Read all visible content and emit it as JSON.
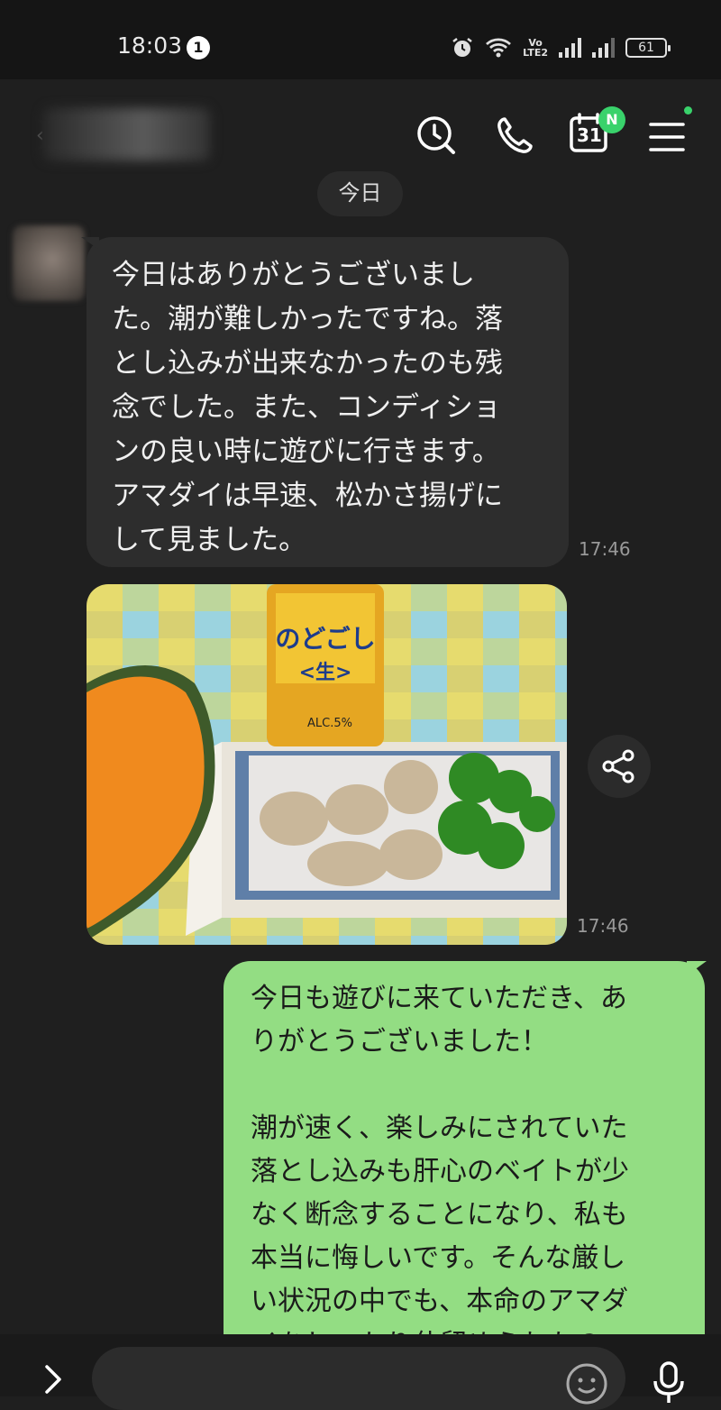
{
  "status_bar": {
    "time": "18:03",
    "notification_count": "1",
    "battery": "61",
    "volte_label": "VoLTE2"
  },
  "header": {
    "contact_name": "■■■■"
  },
  "chat": {
    "date_separator": "今日",
    "incoming_message": {
      "text": "今日はありがとうございまし\nた。潮が難しかったですね。落\nとし込みが出来なかったのも残\n念でした。また、コンディショ\nンの良い時に遊びに行きます。\nアマダイは早速、松かさ揚げに\nして見ました。",
      "time": "17:46"
    },
    "incoming_photo": {
      "time": "17:46",
      "can_label": "のどごし\n<生>",
      "alc_label": "ALC.5%"
    },
    "outgoing_message": {
      "text": "今日も遊びに来ていただき、あ\nりがとうございました！\n\n潮が速く、楽しみにされていた\n落とし込みも肝心のベイトが少\nなく断念することになり、私も\n本当に悔しいです。そんな厳し\nい状況の中でも、本命のアマダ\nイをしっかり仕留められたの"
    }
  },
  "calendar_badge": {
    "day": "31",
    "badge": "N"
  },
  "footer": {
    "input_placeholder": ""
  },
  "colors": {
    "incoming_bubble": "#2d2d2d",
    "outgoing_bubble": "#93dd83",
    "badge_green": "#39d26b"
  }
}
